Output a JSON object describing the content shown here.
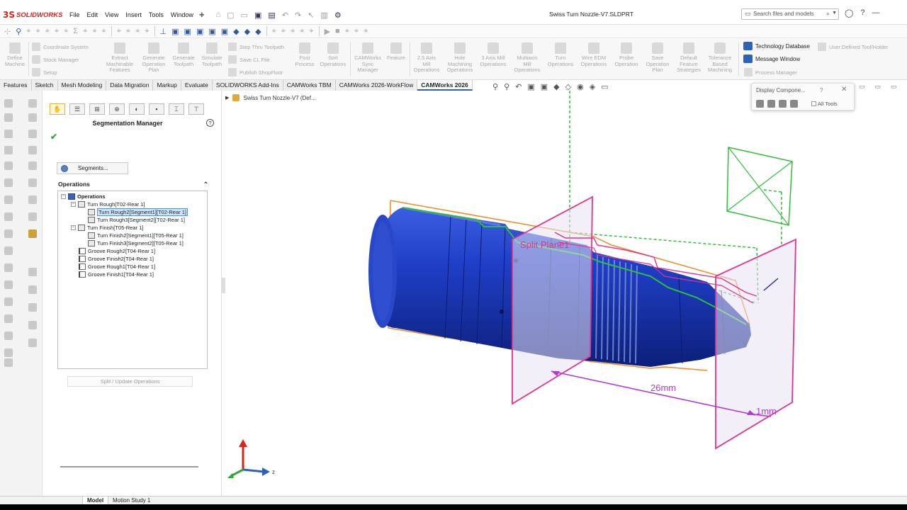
{
  "app": {
    "logo_mark": "3S",
    "logo_word": "SOLIDWORKS",
    "document_title": "Swiss Turn Nozzle-V7.SLDPRT"
  },
  "menu": [
    "File",
    "Edit",
    "View",
    "Insert",
    "Tools",
    "Window"
  ],
  "search": {
    "placeholder": "Search files and models"
  },
  "ribbon": {
    "define_machine": "Define\nMachine",
    "coordinate_system": "Coordinate System",
    "stock_manager": "Stock Manager",
    "setup": "Setup",
    "extract_features": "Extract\nMachinable\nFeatures",
    "generate_plan": "Generate\nOperation\nPlan",
    "generate_toolpath": "Generate\nToolpath",
    "simulate_toolpath": "Simulate\nToolpath",
    "step_thru": "Step Thru Toolpath",
    "save_cl": "Save CL File",
    "publish_shopfloor": "Publish ShopFloor",
    "post_process": "Post\nProcess",
    "sort_operations": "Sort\nOperations",
    "sync_manager": "CAMWorks\nSync\nManager",
    "feature": "Feature",
    "axis_25": "2.5 Axis\nMill\nOperations",
    "hole_machining": "Hole\nMachining\nOperations",
    "axis_3": "3 Axis Mill\nOperations",
    "multiaxis": "Multiaxis\nMill\nOperations",
    "turn_operations": "Turn\nOperations",
    "wire_edm": "Wire EDM\nOperations",
    "probe": "Probe\nOperation",
    "save_plan": "Save\nOperation\nPlan",
    "default_strategies": "Default\nFeature\nStrategies",
    "tolerance_machining": "Tolerance\nBased\nMachining",
    "technology_database": "Technology Database",
    "message_window": "Message Window",
    "process_manager": "Process Manager",
    "user_defined_tool": "User Defined Tool/Holder"
  },
  "tabs": [
    "Features",
    "Sketch",
    "Mesh Modeling",
    "Data Migration",
    "Markup",
    "Evaluate",
    "SOLIDWORKS Add-Ins",
    "CAMWorks TBM",
    "CAMWorks 2026-WorkFlow",
    "CAMWorks 2026"
  ],
  "active_tab": "CAMWorks 2026",
  "panel": {
    "title": "Segmentation Manager",
    "segments_button": "Segments...",
    "operations_header": "Operations",
    "split_button": "Split / Update Operations",
    "tree": [
      {
        "label": "Operations",
        "level": 0,
        "bold": true,
        "selected": false
      },
      {
        "label": "Turn Rough[T02-Rear 1]",
        "level": 1,
        "bold": false,
        "selected": false
      },
      {
        "label": "Turn Rough2[Segment1][T02-Rear 1]",
        "level": 2,
        "bold": false,
        "selected": true
      },
      {
        "label": "Turn Rough3[Segment2][T02-Rear 1]",
        "level": 2,
        "bold": false,
        "selected": false
      },
      {
        "label": "Turn Finish[T05-Rear 1]",
        "level": 1,
        "bold": false,
        "selected": false
      },
      {
        "label": "Turn Finish2[Segment1][T05-Rear 1]",
        "level": 2,
        "bold": false,
        "selected": false
      },
      {
        "label": "Turn Finish3[Segment2][T05-Rear 1]",
        "level": 2,
        "bold": false,
        "selected": false
      },
      {
        "label": "Groove Rough2[T04-Rear 1]",
        "level": 1,
        "bold": false,
        "selected": false
      },
      {
        "label": "Groove Finish2[T04-Rear 1]",
        "level": 1,
        "bold": false,
        "selected": false
      },
      {
        "label": "Groove Rough1[T04-Rear 1]",
        "level": 1,
        "bold": false,
        "selected": false
      },
      {
        "label": "Groove Finish1[T04-Rear 1]",
        "level": 1,
        "bold": false,
        "selected": false
      }
    ]
  },
  "feature_tree_root": "Swiss Turn Nozzle-V7 (Def...",
  "display_popup": {
    "title": "Display Compone...",
    "help": "?",
    "all_tools": "All Tools"
  },
  "viewport": {
    "plane_label": "Split Plane1",
    "dim_26": "26mm",
    "dim_1": "1mm",
    "axis_z": "z",
    "colors": {
      "part": "#1f3fc8",
      "plane": "#e0338f",
      "stock": "#f08a24",
      "profile": "#2fbf3a",
      "dimension": "#b03ad8"
    }
  },
  "bottom_tabs": [
    "Model",
    "Motion Study 1"
  ]
}
